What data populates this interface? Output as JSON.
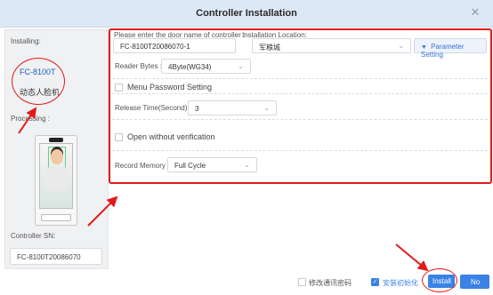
{
  "dialog": {
    "title": "Controller Installation",
    "close_glyph": "✕"
  },
  "left": {
    "installing_label": "Installing:",
    "model": "FC-8100T",
    "model_desc": "动态人脸机",
    "processing_label": "Processing :",
    "sn_label": "Controller SN:",
    "sn_value": "FC-8100T20086070"
  },
  "form": {
    "door_name_label": "Please enter the door name of controller :",
    "door_name_value": "FC-8100T20086070-1",
    "location_label": "Installation Location:",
    "location_value": "军粮城",
    "param_button": "Parameter Setting",
    "param_icon": "caret-down-icon",
    "reader_bytes_label": "Reader Bytes :",
    "reader_bytes_value": "4Byte(WG34)",
    "menu_password_label": "Menu Password Setting",
    "release_time_label": "Release Time(Second) :",
    "release_time_value": "3",
    "open_without_verification_label": "Open without verification",
    "record_memory_label": "Record Memory :",
    "record_memory_value": "Full Cycle"
  },
  "footer": {
    "modify_password_label": "修改通讯密码",
    "modify_password_checked": false,
    "install_init_label": "安装初始化",
    "install_init_checked": true,
    "install_button": "Install",
    "no_button": "No"
  },
  "colors": {
    "accent": "#3b82e6",
    "annotation_red": "#e01b1b",
    "title_bar": "#dde8f5"
  }
}
